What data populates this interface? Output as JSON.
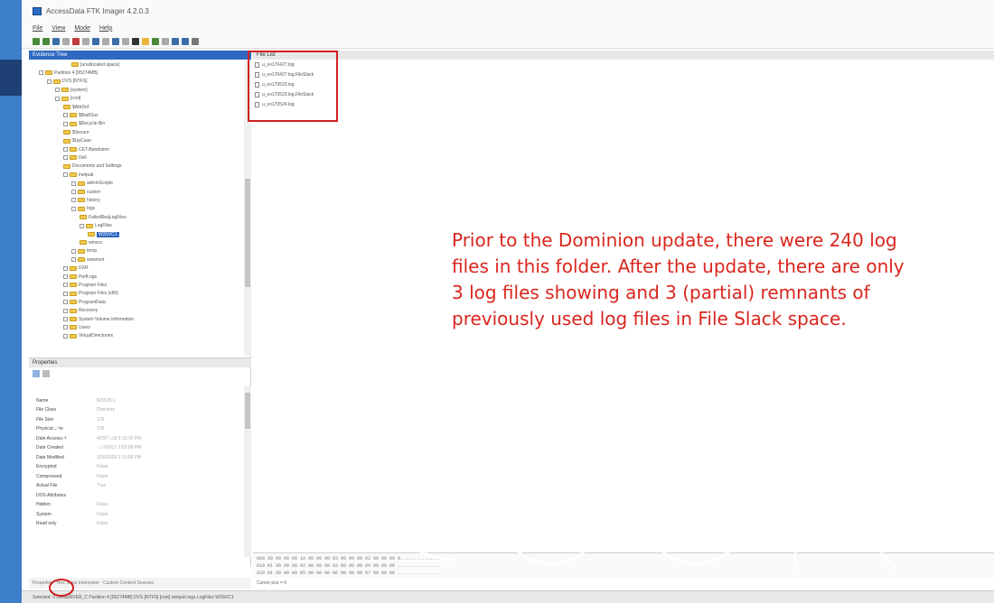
{
  "window": {
    "title": "AccessData FTK Imager 4.2.0.3"
  },
  "menu": [
    "File",
    "View",
    "Mode",
    "Help"
  ],
  "panels": {
    "evidence_tree": "Evidence Tree",
    "file_list": "File List",
    "properties": "Properties"
  },
  "tree": [
    {
      "depth": 5,
      "label": "[unallocated space]",
      "exp": false
    },
    {
      "depth": 1,
      "label": "Partition 4 [95274MB]",
      "exp": true
    },
    {
      "depth": 2,
      "label": "DVS [NTFS]",
      "exp": true
    },
    {
      "depth": 3,
      "label": "[system]",
      "exp": true
    },
    {
      "depth": 3,
      "label": "[root]",
      "exp": true
    },
    {
      "depth": 4,
      "label": "$AttrDef",
      "exp": false
    },
    {
      "depth": 4,
      "label": "$BadClus",
      "exp": true
    },
    {
      "depth": 4,
      "label": "$Recycle.Bin",
      "exp": true
    },
    {
      "depth": 4,
      "label": "$Secure",
      "exp": false
    },
    {
      "depth": 4,
      "label": "$UpCase",
      "exp": false
    },
    {
      "depth": 4,
      "label": "CET-Bandstem",
      "exp": true
    },
    {
      "depth": 4,
      "label": "Dell",
      "exp": true
    },
    {
      "depth": 4,
      "label": "Documents and Settings",
      "exp": false
    },
    {
      "depth": 4,
      "label": "inetpub",
      "exp": true
    },
    {
      "depth": 5,
      "label": "adminScripts",
      "exp": true
    },
    {
      "depth": 5,
      "label": "custerr",
      "exp": true
    },
    {
      "depth": 5,
      "label": "history",
      "exp": true
    },
    {
      "depth": 5,
      "label": "logs",
      "exp": true
    },
    {
      "depth": 6,
      "label": "FailedReqLogFiles",
      "exp": false
    },
    {
      "depth": 6,
      "label": "LogFiles",
      "exp": true
    },
    {
      "depth": 7,
      "label": "W3SVC1",
      "exp": false,
      "selected": true
    },
    {
      "depth": 6,
      "label": "wmsvc",
      "exp": false
    },
    {
      "depth": 5,
      "label": "temp",
      "exp": true
    },
    {
      "depth": 5,
      "label": "wwwroot",
      "exp": true
    },
    {
      "depth": 4,
      "label": "DXR",
      "exp": true
    },
    {
      "depth": 4,
      "label": "PerfLogs",
      "exp": true
    },
    {
      "depth": 4,
      "label": "Program Files",
      "exp": true
    },
    {
      "depth": 4,
      "label": "Program Files (x86)",
      "exp": true
    },
    {
      "depth": 4,
      "label": "ProgramData",
      "exp": true
    },
    {
      "depth": 4,
      "label": "Recovery",
      "exp": true
    },
    {
      "depth": 4,
      "label": "System Volume Information",
      "exp": true
    },
    {
      "depth": 4,
      "label": "Users",
      "exp": true
    },
    {
      "depth": 4,
      "label": "VirtualDirectories",
      "exp": true
    }
  ],
  "files": [
    "u_ex170427.log",
    "u_ex170427.log.FileSlack",
    "u_ex170523.log",
    "u_ex170523.log.FileSlack",
    "u_ex170524.log"
  ],
  "properties": [
    {
      "key": "Name",
      "value": "W3SVC1"
    },
    {
      "key": "File Class",
      "value": "Directory"
    },
    {
      "key": "File Size",
      "value": "176"
    },
    {
      "key": "Physical Size",
      "value": "176"
    },
    {
      "key": "Date Accessed",
      "value": "4/29/2019 3:15:10 PM"
    },
    {
      "key": "Date Created",
      "value": "4/27/2017 1:03:09 PM"
    },
    {
      "key": "Date Modified",
      "value": "1/20/2020 1:10:08 PM"
    },
    {
      "key": "Encrypted",
      "value": "False"
    },
    {
      "key": "Compressed",
      "value": "False"
    },
    {
      "key": "Actual File",
      "value": "True"
    },
    {
      "key": "DOS Attributes",
      "value": ""
    },
    {
      "key": "Hidden",
      "value": "False"
    },
    {
      "key": "System",
      "value": "False"
    },
    {
      "key": "Read only",
      "value": "False"
    }
  ],
  "bottom_tabs": [
    "Properties",
    "Hex Value Interpreter",
    "Custom Content Sources"
  ],
  "annotation": [
    "Prior to the Dominion update, there were 240 log",
    "files in this folder. After the update, there are only",
    "3 log files showing and 3 (partial) remnants of",
    "previously used log files in File Slack space."
  ],
  "hex_lines": [
    "000  30 00 00 00 1A 00 00 00 03 00 00 00 02 00 00 00  0...............",
    "010  01 00 00 00 02 00 00 00 03 00 00 00 04 00 00 00  ................",
    "020  01 00 00 00 05 00 00 00 06 00 00 00 07 00 00 00  ................"
  ],
  "cursor_pos": "Cursor pos = 0",
  "status": "Selected: 0   DMSERVER_C  Partition 4 [95274MB]  DVS [NTFS]  [root]  inetpub  logs  LogFiles  W3SVC1",
  "watermark_text": "Cook",
  "colors": {
    "title_bar": "#2f69c0",
    "annotation": "#d9261d",
    "highlight_box": "#d21f1f"
  }
}
